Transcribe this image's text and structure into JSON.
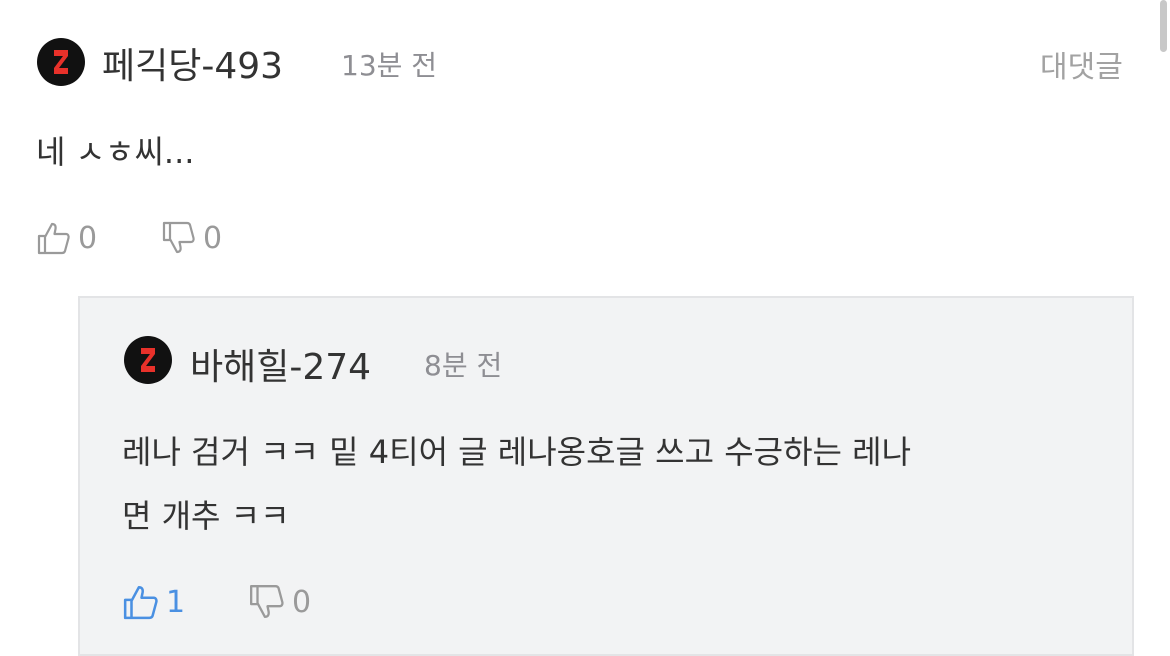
{
  "comment": {
    "username": "페긱당-493",
    "time": "13분 전",
    "reply_action": "대댓글",
    "text": "네 ㅅㅎ씨...",
    "like_count": "0",
    "dislike_count": "0"
  },
  "reply": {
    "username": "바해힐-274",
    "time": "8분 전",
    "text_line1": "레나 검거 ㅋㅋ 밑 4티어 글 레나옹호글 쓰고 수긍하는 레나",
    "text_line2": "면 개추 ㅋㅋ",
    "like_count": "1",
    "dislike_count": "0"
  },
  "colors": {
    "avatar_bg": "#111111",
    "avatar_mark": "#e8312a",
    "liked_blue": "#4a90e2",
    "muted_gray": "#9a9a9a"
  }
}
